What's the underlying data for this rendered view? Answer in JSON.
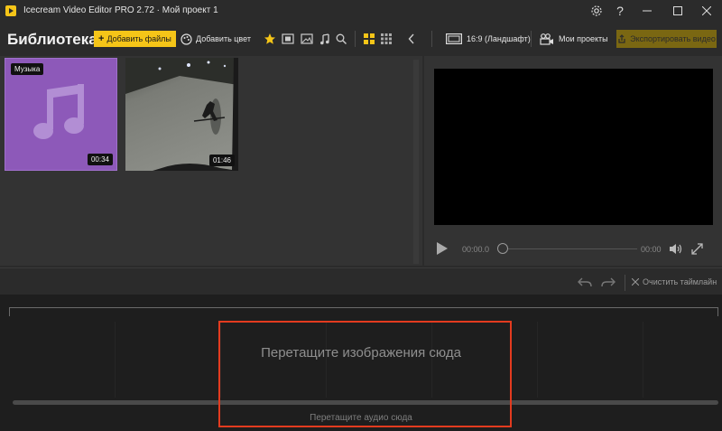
{
  "window": {
    "title": "Icecream Video Editor PRO 2.72   ·   Мой проект 1"
  },
  "toolbar": {
    "library_title": "Библиотека",
    "add_files_label": "Добавить файлы",
    "add_color_label": "Добавить цвет",
    "aspect_label": "16:9 (Ландшафт)",
    "projects_label": "Мои проекты",
    "export_label": "Экспортировать видео"
  },
  "library": {
    "items": [
      {
        "badge": "Музыка",
        "duration": "00:34",
        "type": "audio"
      },
      {
        "badge": "",
        "duration": "01:46",
        "type": "video"
      }
    ]
  },
  "player": {
    "current_time": "00:00.0",
    "total_time": "00:00"
  },
  "timeline": {
    "clear_label": "Очистить таймлайн",
    "drop_images": "Перетащите изображения сюда",
    "drop_audio": "Перетащите аудио сюда"
  },
  "colors": {
    "accent": "#f5c518",
    "highlight": "#e33b1f",
    "music_tile": "#8d59b9"
  }
}
